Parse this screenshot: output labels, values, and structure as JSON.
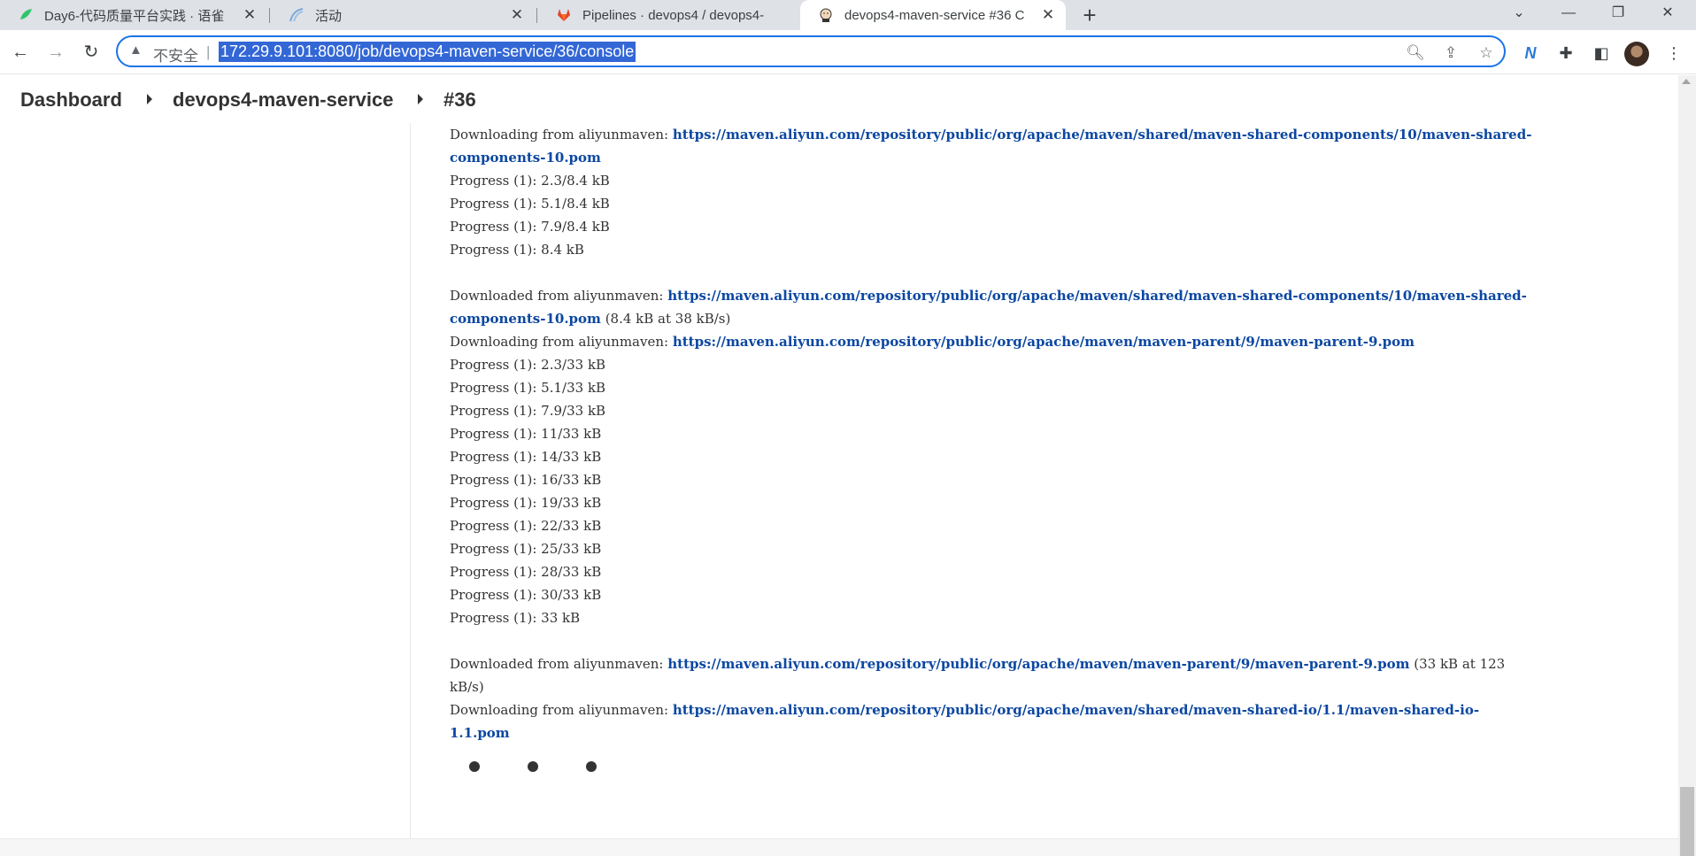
{
  "browser": {
    "tabs": [
      {
        "title": "Day6-代码质量平台实践 · 语雀",
        "favicon": "yuque-icon",
        "color": "#31c46e"
      },
      {
        "title": "活动",
        "favicon": "activity-icon",
        "color": "#7aa7d8"
      },
      {
        "title": "Pipelines · devops4 / devops4-",
        "favicon": "gitlab-icon",
        "color": "#e24329"
      },
      {
        "title": "devops4-maven-service #36 C",
        "favicon": "jenkins-icon",
        "color": "#d24939",
        "active": true
      }
    ],
    "new_tab": "+",
    "address": {
      "insecure_label": "不安全",
      "separator": "|",
      "url": "172.29.9.101:8080/job/devops4-maven-service/36/console"
    },
    "accent": "#1a73e8"
  },
  "breadcrumb": {
    "items": [
      "Dashboard",
      "devops4-maven-service",
      "#36"
    ]
  },
  "console": {
    "lines": [
      {
        "prefix": "Downloading from aliyunmaven: ",
        "link": "https://maven.aliyun.com/repository/public/org/apache/maven/shared/maven-shared-components/10/maven-shared-",
        "suffix": ""
      },
      {
        "prefix": "",
        "link": "components-10.pom",
        "suffix": ""
      },
      {
        "prefix": "Progress (1): 2.3/8.4 kB",
        "link": "",
        "suffix": ""
      },
      {
        "prefix": "Progress (1): 5.1/8.4 kB",
        "link": "",
        "suffix": ""
      },
      {
        "prefix": "Progress (1): 7.9/8.4 kB",
        "link": "",
        "suffix": ""
      },
      {
        "prefix": "Progress (1): 8.4 kB",
        "link": "",
        "suffix": ""
      },
      {
        "prefix": "",
        "link": "",
        "suffix": ""
      },
      {
        "prefix": "Downloaded from aliyunmaven: ",
        "link": "https://maven.aliyun.com/repository/public/org/apache/maven/shared/maven-shared-components/10/maven-shared-",
        "suffix": ""
      },
      {
        "prefix": "",
        "link": "components-10.pom",
        "suffix": " (8.4 kB at 38 kB/s)"
      },
      {
        "prefix": "Downloading from aliyunmaven: ",
        "link": "https://maven.aliyun.com/repository/public/org/apache/maven/maven-parent/9/maven-parent-9.pom",
        "suffix": ""
      },
      {
        "prefix": "Progress (1): 2.3/33 kB",
        "link": "",
        "suffix": ""
      },
      {
        "prefix": "Progress (1): 5.1/33 kB",
        "link": "",
        "suffix": ""
      },
      {
        "prefix": "Progress (1): 7.9/33 kB",
        "link": "",
        "suffix": ""
      },
      {
        "prefix": "Progress (1): 11/33 kB",
        "link": "",
        "suffix": ""
      },
      {
        "prefix": "Progress (1): 14/33 kB",
        "link": "",
        "suffix": ""
      },
      {
        "prefix": "Progress (1): 16/33 kB",
        "link": "",
        "suffix": ""
      },
      {
        "prefix": "Progress (1): 19/33 kB",
        "link": "",
        "suffix": ""
      },
      {
        "prefix": "Progress (1): 22/33 kB",
        "link": "",
        "suffix": ""
      },
      {
        "prefix": "Progress (1): 25/33 kB",
        "link": "",
        "suffix": ""
      },
      {
        "prefix": "Progress (1): 28/33 kB",
        "link": "",
        "suffix": ""
      },
      {
        "prefix": "Progress (1): 30/33 kB",
        "link": "",
        "suffix": ""
      },
      {
        "prefix": "Progress (1): 33 kB",
        "link": "",
        "suffix": ""
      },
      {
        "prefix": "",
        "link": "",
        "suffix": ""
      },
      {
        "prefix": "Downloaded from aliyunmaven: ",
        "link": "https://maven.aliyun.com/repository/public/org/apache/maven/maven-parent/9/maven-parent-9.pom",
        "suffix": " (33 kB at 123"
      },
      {
        "prefix": "kB/s)",
        "link": "",
        "suffix": ""
      },
      {
        "prefix": "Downloading from aliyunmaven: ",
        "link": "https://maven.aliyun.com/repository/public/org/apache/maven/shared/maven-shared-io/1.1/maven-shared-io-",
        "suffix": ""
      },
      {
        "prefix": "",
        "link": "1.1.pom",
        "suffix": ""
      }
    ],
    "link_color": "#0b47a1",
    "text_color": "#333333"
  }
}
